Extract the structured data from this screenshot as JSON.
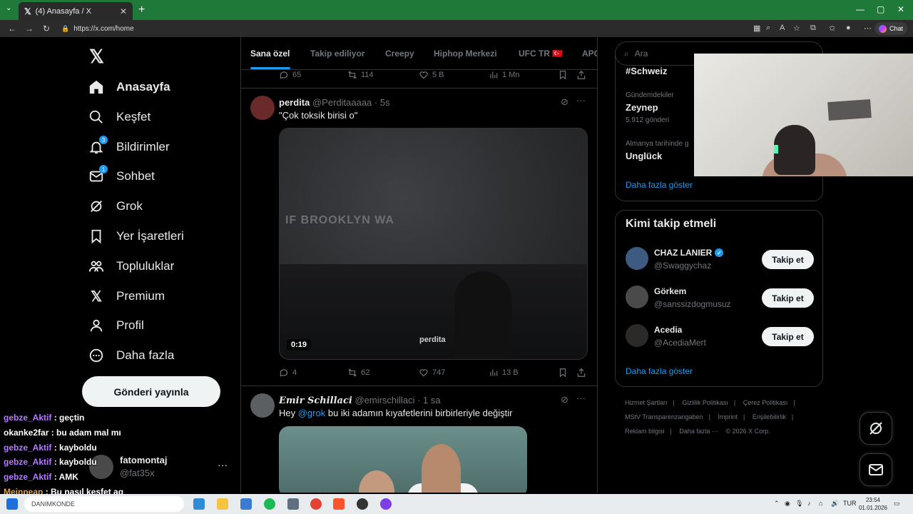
{
  "browser": {
    "tab_title": "(4) Anasayfa / X",
    "url": "https://x.com/home",
    "chat_label": "Chat"
  },
  "nav": {
    "items": [
      {
        "label": "Anasayfa",
        "icon": "home-icon",
        "badge": ""
      },
      {
        "label": "Keşfet",
        "icon": "search-icon",
        "badge": ""
      },
      {
        "label": "Bildirimler",
        "icon": "bell-icon",
        "badge": "3"
      },
      {
        "label": "Sohbet",
        "icon": "mail-icon",
        "badge": "1"
      },
      {
        "label": "Grok",
        "icon": "grok-icon",
        "badge": ""
      },
      {
        "label": "Yer İşaretleri",
        "icon": "bookmark-icon",
        "badge": ""
      },
      {
        "label": "Topluluklar",
        "icon": "communities-icon",
        "badge": ""
      },
      {
        "label": "Premium",
        "icon": "x-logo-icon",
        "badge": ""
      },
      {
        "label": "Profil",
        "icon": "person-icon",
        "badge": ""
      },
      {
        "label": "Daha fazla",
        "icon": "more-circle-icon",
        "badge": ""
      }
    ],
    "post_button": "Gönderi yayınla"
  },
  "account": {
    "name": "fatomontaj",
    "handle": "@fat35x"
  },
  "feed": {
    "tabs": [
      "Sana özel",
      "Takip ediliyor",
      "Creepy",
      "Hiphop Merkezi",
      "UFC TR 🇹🇷",
      "APO"
    ],
    "prev_actions": {
      "replies": "65",
      "reposts": "114",
      "likes": "5 B",
      "views": "1 Mn"
    },
    "tweets": [
      {
        "name": "perdita",
        "handle": "@Perditaaaaa",
        "time": "· 5s",
        "text": "\"Çok toksik birisi o\"",
        "media": {
          "duration": "0:19",
          "watermark": "perdita",
          "wall_text": "IF BROOKLYN WA"
        },
        "actions": {
          "replies": "4",
          "reposts": "62",
          "likes": "747",
          "views": "13 B"
        }
      },
      {
        "name": "Emir Schillaci",
        "handle": "@emirschillaci",
        "time": "· 1 sa",
        "text_prefix": "Hey ",
        "mention": "@grok",
        "text_suffix": " bu iki adamın kıyafetlerini birbirleriyle değiştir"
      }
    ]
  },
  "sidebar": {
    "search_placeholder": "Ara",
    "trends": [
      {
        "context": "",
        "name": "#Schweiz",
        "count": ""
      },
      {
        "context": "Gündemdekiler",
        "name": "Zeynep",
        "count": "5.912 gönderi"
      },
      {
        "context": "Almanya tarihinde g",
        "name": "Unglück",
        "count": ""
      }
    ],
    "trends_more": "Daha fazla göster",
    "who_to_follow": {
      "title": "Kimi takip etmeli",
      "users": [
        {
          "name": "CHAZ LANIER",
          "handle": "@Swaggychaz",
          "verified": true,
          "button": "Takip et"
        },
        {
          "name": "Görkem",
          "handle": "@sanssizdogmusuz",
          "verified": false,
          "button": "Takip et"
        },
        {
          "name": "Acedia",
          "handle": "@AcediaMert",
          "verified": false,
          "button": "Takip et"
        }
      ],
      "more": "Daha fazla göster"
    },
    "footer": [
      "Hizmet Şartları",
      "|",
      "Gizlilik Politikası",
      "|",
      "Çerez Politikası",
      "|",
      "MStV Transparenzangaben",
      "|",
      "Imprint",
      "|",
      "Erişilebilirlik",
      "|",
      "Reklam bilgisi",
      "|",
      "Daha fazla ···",
      "© 2026 X Corp."
    ]
  },
  "stream_chat": [
    {
      "user": "gebze_Aktif",
      "msg": ": geçtin",
      "color": "u1"
    },
    {
      "user": "okanke2far",
      "msg": ": bu adam mal mı",
      "color": "u2"
    },
    {
      "user": "gebze_Aktif",
      "msg": ": kayboldu",
      "color": "u1"
    },
    {
      "user": "gebze_Aktif",
      "msg": ": kayboldu",
      "color": "u1"
    },
    {
      "user": "gebze_Aktif",
      "msg": ": AMK",
      "color": "u1"
    },
    {
      "user": "Meinnean",
      "msg": ": Bu nasıl keşfet aq",
      "color": "u3"
    }
  ],
  "taskbar": {
    "search_text": "DANIMKONDE",
    "lang": "TUR",
    "time": "23:54",
    "date": "01.01.2026"
  },
  "colors": {
    "accent": "#1d9bf0",
    "background": "#000000",
    "browser_frame": "#1f7a3a"
  }
}
